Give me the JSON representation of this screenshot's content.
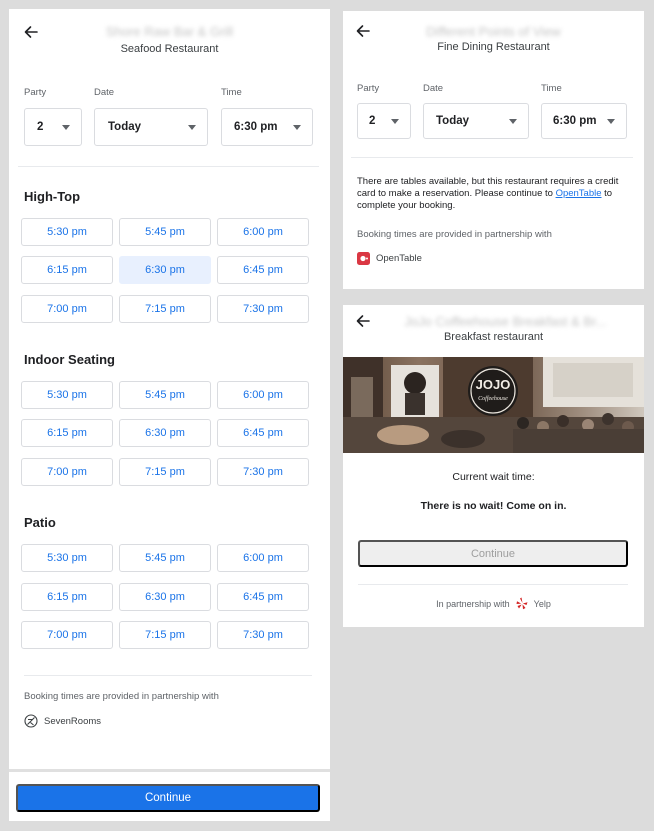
{
  "left": {
    "title_blurred": "Shore Raw Bar & Grill",
    "subtitle": "Seafood Restaurant",
    "party_label": "Party",
    "date_label": "Date",
    "time_label": "Time",
    "party_value": "2",
    "date_value": "Today",
    "time_value": "6:30 pm",
    "sections": [
      {
        "title": "High-Top",
        "slots": [
          "5:30 pm",
          "5:45 pm",
          "6:00 pm",
          "6:15 pm",
          "6:30 pm",
          "6:45 pm",
          "7:00 pm",
          "7:15 pm",
          "7:30 pm"
        ]
      },
      {
        "title": "Indoor Seating",
        "slots": [
          "5:30 pm",
          "5:45 pm",
          "6:00 pm",
          "6:15 pm",
          "6:30 pm",
          "6:45 pm",
          "7:00 pm",
          "7:15 pm",
          "7:30 pm"
        ]
      },
      {
        "title": "Patio",
        "slots": [
          "5:30 pm",
          "5:45 pm",
          "6:00 pm",
          "6:15 pm",
          "6:30 pm",
          "6:45 pm",
          "7:00 pm",
          "7:15 pm",
          "7:30 pm"
        ]
      }
    ],
    "partner_text": "Booking times are provided in partnership with",
    "partner_name": "SevenRooms",
    "continue_label": "Continue",
    "accent_color": "#1a73e8"
  },
  "top_right": {
    "title_blurred": "Different Points of View",
    "subtitle": "Fine Dining Restaurant",
    "party_label": "Party",
    "date_label": "Date",
    "time_label": "Time",
    "party_value": "2",
    "date_value": "Today",
    "time_value": "6:30 pm",
    "notice_pre": "There are tables available, but this restaurant requires a credit card to make a reservation. Please continue to ",
    "notice_link": "OpenTable",
    "notice_post": " to complete your booking.",
    "partner_text": "Booking times are provided in partnership with",
    "partner_name": "OpenTable",
    "partner_color": "#da3743"
  },
  "bottom_right": {
    "title_blurred": "JoJo Coffeehouse Breakfast & Br...",
    "subtitle": "Breakfast restaurant",
    "photo_sign_line1": "JOJO",
    "photo_sign_line2": "Coffeehouse",
    "wait_label": "Current wait time:",
    "wait_value": "There is no wait! Come on in.",
    "continue_label": "Continue",
    "partner_prefix": "In partnership with",
    "partner_name": "Yelp",
    "partner_color": "#d32323"
  }
}
